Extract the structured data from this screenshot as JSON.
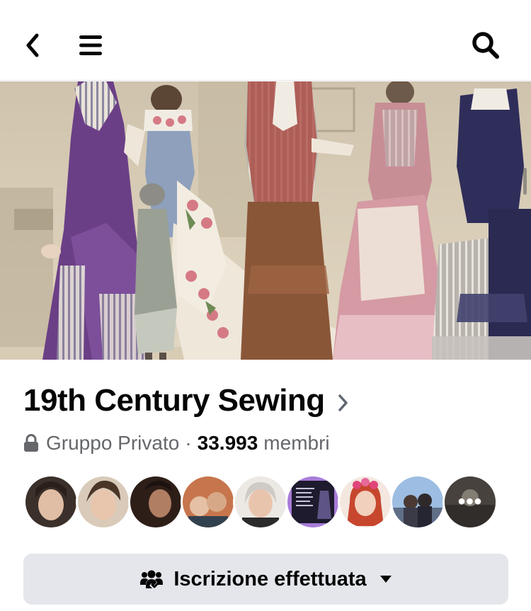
{
  "nav": {
    "back_icon": "chevron-left-icon",
    "menu_icon": "hamburger-menu-icon",
    "search_icon": "search-icon"
  },
  "group": {
    "name": "19th Century Sewing",
    "privacy_icon": "lock-icon",
    "privacy": "Gruppo Privato",
    "separator": "·",
    "member_count": "33.993",
    "member_label": "membri"
  },
  "members_preview": {
    "avatars": [
      "avatar-1",
      "avatar-2",
      "avatar-3",
      "avatar-4",
      "avatar-5",
      "avatar-6",
      "avatar-7",
      "avatar-8"
    ],
    "more_label": "•••"
  },
  "join_button": {
    "icon": "members-check-icon",
    "label": "Iscrizione effettuata",
    "dropdown_icon": "caret-down-icon"
  },
  "colors": {
    "button_bg": "#e4e6eb",
    "text_primary": "#050505",
    "text_secondary": "#65676b"
  }
}
